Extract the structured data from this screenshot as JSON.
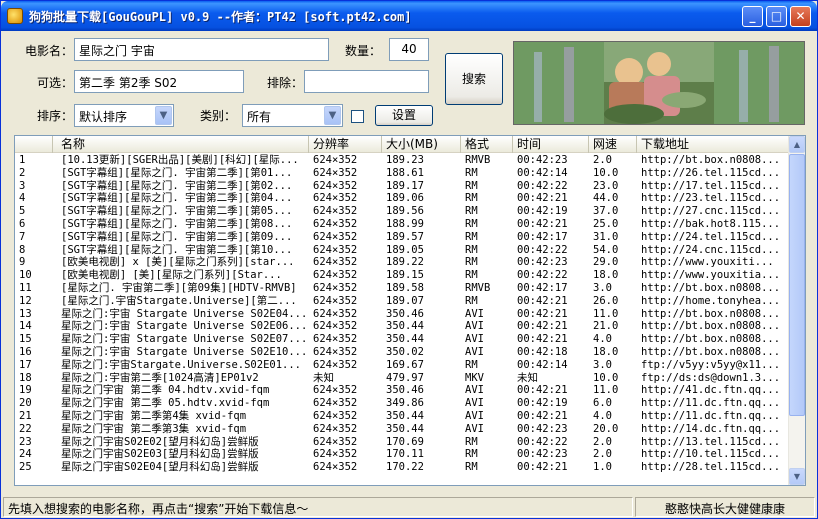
{
  "window": {
    "title": "狗狗批量下载[GouGouPL] v0.9 --作者：PT42 [soft.pt42.com]",
    "controls": {
      "minimize": "_",
      "maximize": "□",
      "close": "✕"
    }
  },
  "form": {
    "movie_name_label": "电影名：",
    "movie_name_value": "星际之门 宇宙",
    "quantity_label": "数量：",
    "quantity_value": "40",
    "optional_label": "可选：",
    "optional_value": "第二季 第2季 S02",
    "exclude_label": "排除：",
    "exclude_value": "",
    "sort_label": "排序：",
    "sort_value": "默认排序",
    "category_label": "类别：",
    "category_value": "所有",
    "search_button": "搜索",
    "settings_button": "设置"
  },
  "table": {
    "columns": [
      "名称",
      "分辨率",
      "大小(MB)",
      "格式",
      "时间",
      "网速",
      "下载地址"
    ],
    "rows": [
      [
        "1",
        "[10.13更新][SGER出品][美剧][科幻][星际...",
        "624×352",
        "189.23",
        "RMVB",
        "00:42:23",
        "2.0",
        "http://bt.box.n0808..."
      ],
      [
        "2",
        "[SGT字幕组][星际之门. 宇宙第二季][第01...",
        "624×352",
        "188.61",
        "RM",
        "00:42:14",
        "10.0",
        "http://26.tel.115cd..."
      ],
      [
        "3",
        "[SGT字幕组][星际之门. 宇宙第二季][第02...",
        "624×352",
        "189.17",
        "RM",
        "00:42:22",
        "23.0",
        "http://17.tel.115cd..."
      ],
      [
        "4",
        "[SGT字幕组][星际之门. 宇宙第二季][第04...",
        "624×352",
        "189.06",
        "RM",
        "00:42:21",
        "44.0",
        "http://23.tel.115cd..."
      ],
      [
        "5",
        "[SGT字幕组][星际之门. 宇宙第二季][第05...",
        "624×352",
        "189.56",
        "RM",
        "00:42:19",
        "37.0",
        "http://27.cnc.115cd..."
      ],
      [
        "6",
        "[SGT字幕组][星际之门. 宇宙第二季][第08...",
        "624×352",
        "188.99",
        "RM",
        "00:42:21",
        "25.0",
        "http://bak.hot8.115..."
      ],
      [
        "7",
        "[SGT字幕组][星际之门. 宇宙第二季][第09...",
        "624×352",
        "189.57",
        "RM",
        "00:42:17",
        "31.0",
        "http://24.tel.115cd..."
      ],
      [
        "8",
        "[SGT字幕组][星际之门. 宇宙第二季][第10...",
        "624×352",
        "189.05",
        "RM",
        "00:42:22",
        "54.0",
        "http://24.cnc.115cd..."
      ],
      [
        "9",
        "[欧美电视剧] x [美][星际之门系列][star...",
        "624×352",
        "189.22",
        "RM",
        "00:42:23",
        "29.0",
        "http://www.youxiti..."
      ],
      [
        "10",
        "[欧美电视剧] [美][星际之门系列][Star...",
        "624×352",
        "189.15",
        "RM",
        "00:42:22",
        "18.0",
        "http://www.youxitia..."
      ],
      [
        "11",
        "[星际之门. 宇宙第二季][第09集][HDTV-RMVB]",
        "624×352",
        "189.58",
        "RMVB",
        "00:42:17",
        "3.0",
        "http://bt.box.n0808..."
      ],
      [
        "12",
        "[星际之门.宇宙Stargate.Universe][第二...",
        "624×352",
        "189.07",
        "RM",
        "00:42:21",
        "26.0",
        "http://home.tonyhea..."
      ],
      [
        "13",
        "星际之门:宇宙 Stargate Universe S02E04...",
        "624×352",
        "350.46",
        "AVI",
        "00:42:21",
        "11.0",
        "http://bt.box.n0808..."
      ],
      [
        "14",
        "星际之门:宇宙 Stargate Universe S02E06...",
        "624×352",
        "350.44",
        "AVI",
        "00:42:21",
        "21.0",
        "http://bt.box.n0808..."
      ],
      [
        "15",
        "星际之门:宇宙 Stargate Universe S02E07...",
        "624×352",
        "350.44",
        "AVI",
        "00:42:21",
        "4.0",
        "http://bt.box.n0808..."
      ],
      [
        "16",
        "星际之门:宇宙 Stargate Universe S02E10...",
        "624×352",
        "350.02",
        "AVI",
        "00:42:18",
        "18.0",
        "http://bt.box.n0808..."
      ],
      [
        "17",
        "星际之门:宇宙Stargate.Universe.S02E01...",
        "624×352",
        "169.67",
        "RM",
        "00:42:14",
        "3.0",
        "ftp://v5yy:v5yy@x11..."
      ],
      [
        "18",
        "星际之门:宇宙第二季[1024高清]EP01v2",
        "未知",
        "479.97",
        "MKV",
        "未知",
        "10.0",
        "ftp://ds:ds@down1.3..."
      ],
      [
        "19",
        "星际之门宇宙 第二季 04.hdtv.xvid-fqm",
        "624×352",
        "350.46",
        "AVI",
        "00:42:21",
        "11.0",
        "http://41.dc.ftn.qq..."
      ],
      [
        "20",
        "星际之门宇宙 第二季 05.hdtv.xvid-fqm",
        "624×352",
        "349.86",
        "AVI",
        "00:42:19",
        "6.0",
        "http://11.dc.ftn.qq..."
      ],
      [
        "21",
        "星际之门宇宙 第二季第4集 xvid-fqm",
        "624×352",
        "350.44",
        "AVI",
        "00:42:21",
        "4.0",
        "http://11.dc.ftn.qq..."
      ],
      [
        "22",
        "星际之门宇宙 第二季第3集 xvid-fqm",
        "624×352",
        "350.44",
        "AVI",
        "00:42:23",
        "20.0",
        "http://14.dc.ftn.qq..."
      ],
      [
        "23",
        "星际之门宇宙S02E02[望月科幻岛]尝鲜版",
        "624×352",
        "170.69",
        "RM",
        "00:42:22",
        "2.0",
        "http://13.tel.115cd..."
      ],
      [
        "24",
        "星际之门宇宙S02E03[望月科幻岛]尝鲜版",
        "624×352",
        "170.11",
        "RM",
        "00:42:23",
        "2.0",
        "http://10.tel.115cd..."
      ],
      [
        "25",
        "星际之门宇宙S02E04[望月科幻岛]尝鲜版",
        "624×352",
        "170.22",
        "RM",
        "00:42:21",
        "1.0",
        "http://28.tel.115cd..."
      ]
    ]
  },
  "status": {
    "left": "先填入想搜索的电影名称，再点击“搜索”开始下载信息～",
    "right": "憨憨快高长大健健康康"
  },
  "icons": {
    "sort_dropdown": "chevron-down-icon",
    "category_dropdown": "chevron-down-icon",
    "scroll_up": "arrow-up-icon",
    "scroll_down": "arrow-down-icon"
  },
  "colors": {
    "titlebar": "#0a5bee",
    "window_bg": "#ece9d8",
    "input_border": "#7f9db9"
  }
}
